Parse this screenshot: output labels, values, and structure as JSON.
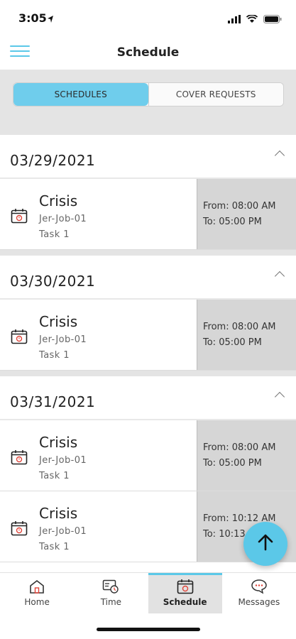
{
  "status_bar": {
    "time": "3:05"
  },
  "nav": {
    "title": "Schedule"
  },
  "segments": {
    "schedules": "SCHEDULES",
    "cover_requests": "COVER REQUESTS"
  },
  "groups": [
    {
      "date": "03/29/2021",
      "shifts": [
        {
          "title": "Crisis",
          "job": "Jer-Job-01",
          "task": "Task 1",
          "from": "From: 08:00 AM",
          "to": "To: 05:00 PM"
        }
      ]
    },
    {
      "date": "03/30/2021",
      "shifts": [
        {
          "title": "Crisis",
          "job": "Jer-Job-01",
          "task": "Task 1",
          "from": "From: 08:00 AM",
          "to": "To: 05:00 PM"
        }
      ]
    },
    {
      "date": "03/31/2021",
      "shifts": [
        {
          "title": "Crisis",
          "job": "Jer-Job-01",
          "task": "Task 1",
          "from": "From: 08:00 AM",
          "to": "To: 05:00 PM"
        },
        {
          "title": "Crisis",
          "job": "Jer-Job-01",
          "task": "Task 1",
          "from": "From: 10:12 AM",
          "to": "To: 10:13"
        }
      ]
    }
  ],
  "tabs": [
    {
      "label": "Home",
      "icon": "home-icon"
    },
    {
      "label": "Time",
      "icon": "timecard-icon"
    },
    {
      "label": "Schedule",
      "icon": "calendar-icon",
      "active": true
    },
    {
      "label": "Messages",
      "icon": "chat-icon"
    }
  ],
  "colors": {
    "accent": "#5bc8e8",
    "segment_active": "#6fcdec",
    "time_cell": "#d6d6d6"
  }
}
